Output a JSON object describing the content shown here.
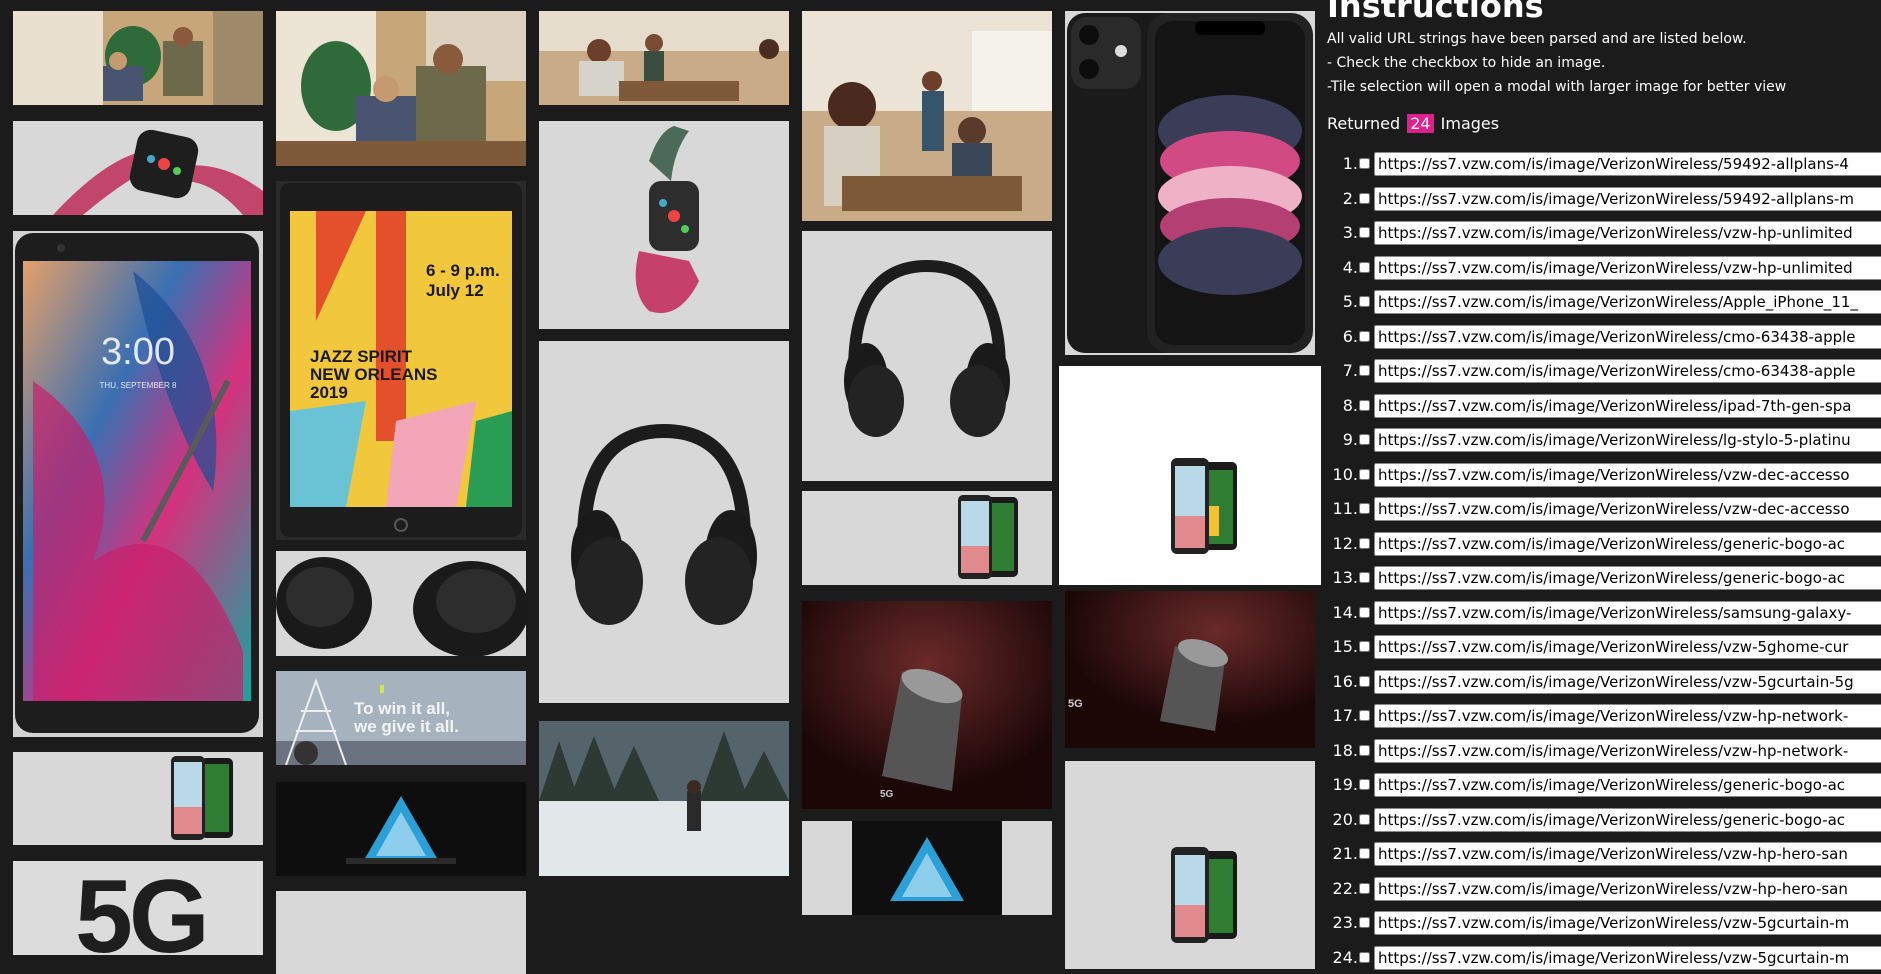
{
  "panel": {
    "title": "Instructions",
    "instructions": [
      "All valid URL strings have been parsed and are listed below.",
      "- Check the checkbox to hide an image.",
      "-Tile selection will open a modal with larger image for better view"
    ],
    "returned_prefix": "Returned",
    "returned_count": "24",
    "returned_suffix": "Images"
  },
  "urls": [
    {
      "n": "1.",
      "url": "https://ss7.vzw.com/is/image/VerizonWireless/59492-allplans-4"
    },
    {
      "n": "2.",
      "url": "https://ss7.vzw.com/is/image/VerizonWireless/59492-allplans-m"
    },
    {
      "n": "3.",
      "url": "https://ss7.vzw.com/is/image/VerizonWireless/vzw-hp-unlimited"
    },
    {
      "n": "4.",
      "url": "https://ss7.vzw.com/is/image/VerizonWireless/vzw-hp-unlimited"
    },
    {
      "n": "5.",
      "url": "https://ss7.vzw.com/is/image/VerizonWireless/Apple_iPhone_11_"
    },
    {
      "n": "6.",
      "url": "https://ss7.vzw.com/is/image/VerizonWireless/cmo-63438-apple"
    },
    {
      "n": "7.",
      "url": "https://ss7.vzw.com/is/image/VerizonWireless/cmo-63438-apple"
    },
    {
      "n": "8.",
      "url": "https://ss7.vzw.com/is/image/VerizonWireless/ipad-7th-gen-spa"
    },
    {
      "n": "9.",
      "url": "https://ss7.vzw.com/is/image/VerizonWireless/lg-stylo-5-platinu"
    },
    {
      "n": "10.",
      "url": "https://ss7.vzw.com/is/image/VerizonWireless/vzw-dec-accesso"
    },
    {
      "n": "11.",
      "url": "https://ss7.vzw.com/is/image/VerizonWireless/vzw-dec-accesso"
    },
    {
      "n": "12.",
      "url": "https://ss7.vzw.com/is/image/VerizonWireless/generic-bogo-ac"
    },
    {
      "n": "13.",
      "url": "https://ss7.vzw.com/is/image/VerizonWireless/generic-bogo-ac"
    },
    {
      "n": "14.",
      "url": "https://ss7.vzw.com/is/image/VerizonWireless/samsung-galaxy-"
    },
    {
      "n": "15.",
      "url": "https://ss7.vzw.com/is/image/VerizonWireless/vzw-5ghome-cur"
    },
    {
      "n": "16.",
      "url": "https://ss7.vzw.com/is/image/VerizonWireless/vzw-5gcurtain-5g"
    },
    {
      "n": "17.",
      "url": "https://ss7.vzw.com/is/image/VerizonWireless/vzw-hp-network-"
    },
    {
      "n": "18.",
      "url": "https://ss7.vzw.com/is/image/VerizonWireless/vzw-hp-network-"
    },
    {
      "n": "19.",
      "url": "https://ss7.vzw.com/is/image/VerizonWireless/generic-bogo-ac"
    },
    {
      "n": "20.",
      "url": "https://ss7.vzw.com/is/image/VerizonWireless/generic-bogo-ac"
    },
    {
      "n": "21.",
      "url": "https://ss7.vzw.com/is/image/VerizonWireless/vzw-hp-hero-san"
    },
    {
      "n": "22.",
      "url": "https://ss7.vzw.com/is/image/VerizonWireless/vzw-hp-hero-san"
    },
    {
      "n": "23.",
      "url": "https://ss7.vzw.com/is/image/VerizonWireless/vzw-5gcurtain-m"
    },
    {
      "n": "24.",
      "url": "https://ss7.vzw.com/is/image/VerizonWireless/vzw-5gcurtain-m"
    }
  ],
  "tiles": {
    "ipad_text_1": "6 - 9 p.m.",
    "ipad_text_2": "July 12",
    "ipad_text_3": "JAZZ SPIRIT",
    "ipad_text_4": "NEW ORLEANS",
    "ipad_text_5": "2019",
    "phone_time": "3:00",
    "phone_date": "THU, SEPTEMBER 8",
    "network_line1": "To win it all,",
    "network_line2": "we give it all.",
    "label_5g": "5G",
    "label_5g_small": "5G"
  }
}
